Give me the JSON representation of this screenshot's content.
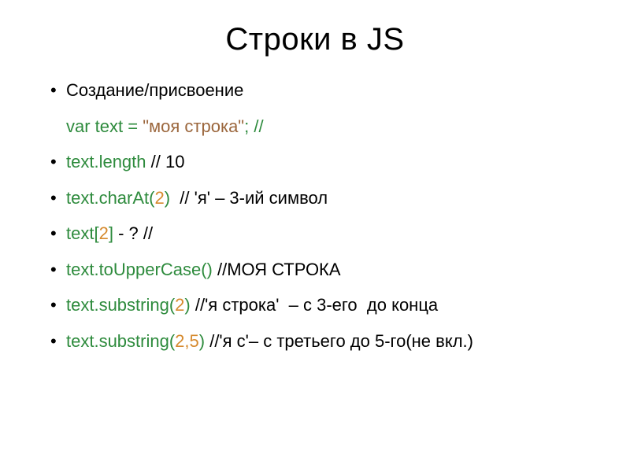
{
  "title": "Строки в JS",
  "lines": [
    {
      "bulleted": true,
      "segments": [
        {
          "text": "Создание/присвоение",
          "color": "black"
        }
      ]
    },
    {
      "bulleted": false,
      "segments": [
        {
          "text": "var text = ",
          "color": "green"
        },
        {
          "text": "\"моя строка\"",
          "color": "brown"
        },
        {
          "text": "; //",
          "color": "green"
        }
      ]
    },
    {
      "bulleted": true,
      "segments": [
        {
          "text": "text.length",
          "color": "green"
        },
        {
          "text": " // 10",
          "color": "black"
        }
      ]
    },
    {
      "bulleted": true,
      "segments": [
        {
          "text": "text.charAt(",
          "color": "green"
        },
        {
          "text": "2",
          "color": "orange"
        },
        {
          "text": ") ",
          "color": "green"
        },
        {
          "text": " // 'я' – 3-ий символ",
          "color": "black"
        }
      ]
    },
    {
      "bulleted": true,
      "segments": [
        {
          "text": "text[",
          "color": "green"
        },
        {
          "text": "2",
          "color": "orange"
        },
        {
          "text": "]",
          "color": "green"
        },
        {
          "text": " - ? //",
          "color": "black"
        }
      ]
    },
    {
      "bulleted": true,
      "segments": [
        {
          "text": "text.toUpperCase()",
          "color": "green"
        },
        {
          "text": " //МОЯ СТРОКА",
          "color": "black"
        }
      ]
    },
    {
      "bulleted": true,
      "segments": [
        {
          "text": "text.substring(",
          "color": "green"
        },
        {
          "text": "2",
          "color": "orange"
        },
        {
          "text": ")",
          "color": "green"
        },
        {
          "text": " //'я строка'  – с 3-его  до конца",
          "color": "black"
        }
      ]
    },
    {
      "bulleted": true,
      "segments": [
        {
          "text": "text.substring(",
          "color": "green"
        },
        {
          "text": "2,5",
          "color": "orange"
        },
        {
          "text": ")",
          "color": "green"
        },
        {
          "text": " //'я с'– с третьего до 5-го(не вкл.)",
          "color": "black"
        }
      ]
    }
  ]
}
